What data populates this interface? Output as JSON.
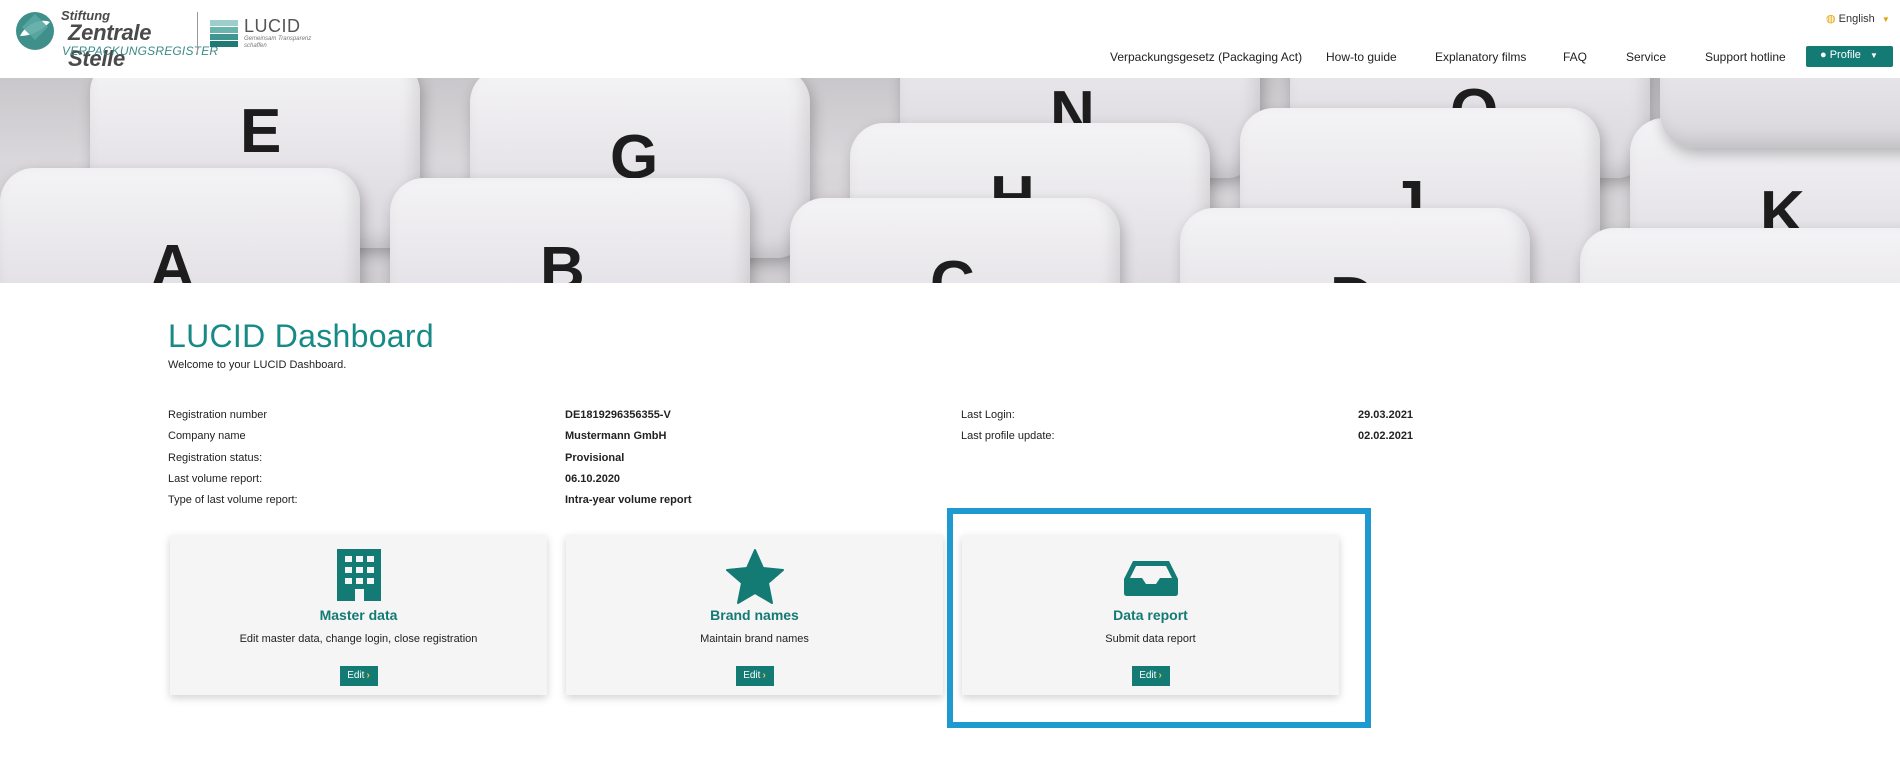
{
  "header": {
    "logo": {
      "line1": "Stiftung",
      "line2": "Zentrale Stelle",
      "line3": "VERPACKUNGSREGISTER"
    },
    "lucid_logo": {
      "name": "LUCID",
      "tagline": "Gemeinsam Transparenz schaffen"
    },
    "language": "English",
    "nav": [
      "Verpackungsgesetz (Packaging Act)",
      "How-to guide",
      "Explanatory films",
      "FAQ",
      "Service",
      "Support hotline"
    ],
    "profile_label": "Profile"
  },
  "banner": {
    "keys": [
      "E",
      "G",
      "N",
      "O",
      "A",
      "B",
      "H",
      "C",
      "J",
      "K",
      "D"
    ]
  },
  "main": {
    "title": "LUCID Dashboard",
    "welcome": "Welcome to your LUCID Dashboard.",
    "info_left": [
      {
        "label": "Registration number",
        "value": "DE1819296356355-V"
      },
      {
        "label": "Company name",
        "value": "Mustermann GmbH"
      },
      {
        "label": "Registration status:",
        "value": "Provisional"
      },
      {
        "label": "Last volume report:",
        "value": "06.10.2020"
      },
      {
        "label": "Type of last volume report:",
        "value": "Intra-year volume report"
      }
    ],
    "info_right": [
      {
        "label": "Last Login:",
        "value": "29.03.2021"
      },
      {
        "label": "Last profile update:",
        "value": "02.02.2021"
      }
    ],
    "cards": [
      {
        "icon": "building-icon",
        "title": "Master data",
        "description": "Edit master data, change login, close registration",
        "button": "Edit"
      },
      {
        "icon": "star-icon",
        "title": "Brand names",
        "description": "Maintain brand names",
        "button": "Edit"
      },
      {
        "icon": "inbox-tray-icon",
        "title": "Data report",
        "description": "Submit data report",
        "button": "Edit"
      }
    ]
  },
  "colors": {
    "brand_teal": "#137a74",
    "title_teal": "#168a86",
    "highlight_blue": "#1e9ad0",
    "accent_yellow": "#f0c23b"
  }
}
